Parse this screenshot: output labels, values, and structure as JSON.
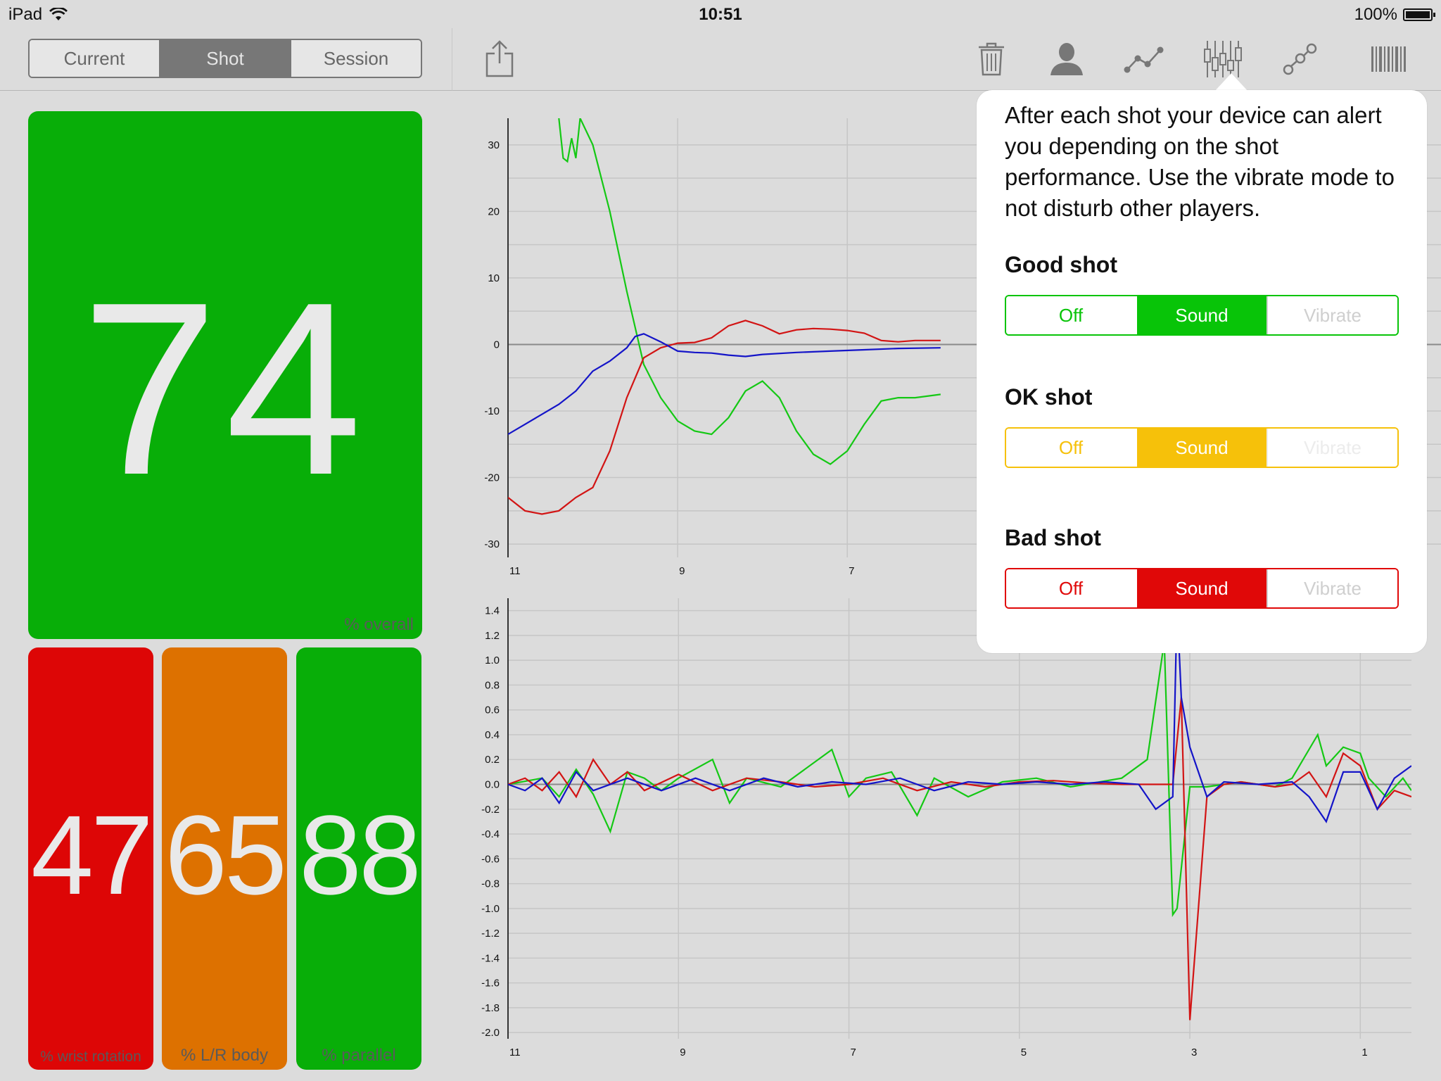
{
  "status_bar": {
    "device": "iPad",
    "time": "10:51",
    "battery": "100%"
  },
  "segmented": {
    "items": [
      "Current",
      "Shot",
      "Session"
    ],
    "selected": 1
  },
  "toolbar": {
    "icons": [
      "share-icon",
      "trash-icon",
      "person-icon",
      "line-graph-icon",
      "candlestick-icon",
      "scatter-icon",
      "barcode-icon"
    ]
  },
  "scores": {
    "overall": {
      "value": "74",
      "label": "% overall",
      "color": "#08ae08"
    },
    "wrist": {
      "value": "47",
      "label": "% wrist rotation",
      "color": "#dd0606"
    },
    "body": {
      "value": "65",
      "label": "% L/R body",
      "color": "#dd7100"
    },
    "parallel": {
      "value": "88",
      "label": "% parallel",
      "color": "#08ae08"
    }
  },
  "popover": {
    "text": "After each shot your device can alert you depending on the shot performance. Use the vibrate mode to not disturb other players.",
    "good": {
      "title": "Good shot",
      "options": [
        "Off",
        "Sound",
        "Vibrate"
      ],
      "selected": "Sound",
      "color": "#08c408"
    },
    "ok": {
      "title": "OK shot",
      "options": [
        "Off",
        "Sound",
        "Vibrate"
      ],
      "selected": "Sound",
      "color": "#f6c10a"
    },
    "bad": {
      "title": "Bad shot",
      "options": [
        "Off",
        "Sound",
        "Vibrate"
      ],
      "selected": "Sound",
      "color": "#e00808"
    }
  },
  "chart_data": [
    {
      "type": "line",
      "title": "",
      "xlabel": "",
      "ylabel": "",
      "xlim": [
        11,
        0
      ],
      "ylim": [
        -32,
        34
      ],
      "x_ticks": [
        11,
        9,
        7
      ],
      "y_ticks": [
        30,
        20,
        10,
        0,
        -10,
        -20,
        -30
      ],
      "grid": true,
      "series": [
        {
          "color": "#14c814",
          "points": [
            [
              10.4,
              34
            ],
            [
              10.35,
              28
            ],
            [
              10.3,
              27.5
            ],
            [
              10.25,
              31
            ],
            [
              10.2,
              28
            ],
            [
              10.15,
              34
            ],
            [
              10.0,
              30
            ],
            [
              9.8,
              20
            ],
            [
              9.6,
              8
            ],
            [
              9.4,
              -3
            ],
            [
              9.2,
              -8
            ],
            [
              9.0,
              -11.5
            ],
            [
              8.8,
              -13
            ],
            [
              8.6,
              -13.5
            ],
            [
              8.4,
              -11
            ],
            [
              8.2,
              -7
            ],
            [
              8.0,
              -5.5
            ],
            [
              7.8,
              -8
            ],
            [
              7.6,
              -13
            ],
            [
              7.4,
              -16.5
            ],
            [
              7.2,
              -18
            ],
            [
              7.0,
              -16
            ],
            [
              6.8,
              -12
            ],
            [
              6.6,
              -8.5
            ],
            [
              6.4,
              -8
            ],
            [
              6.2,
              -8
            ],
            [
              5.9,
              -7.5
            ]
          ]
        },
        {
          "color": "#d21414",
          "points": [
            [
              11.0,
              -23
            ],
            [
              10.8,
              -25
            ],
            [
              10.6,
              -25.5
            ],
            [
              10.4,
              -25
            ],
            [
              10.2,
              -23
            ],
            [
              10.0,
              -21.5
            ],
            [
              9.8,
              -16
            ],
            [
              9.6,
              -8
            ],
            [
              9.4,
              -2
            ],
            [
              9.2,
              -0.5
            ],
            [
              9.0,
              0.2
            ],
            [
              8.8,
              0.3
            ],
            [
              8.6,
              1
            ],
            [
              8.4,
              2.8
            ],
            [
              8.2,
              3.6
            ],
            [
              8.0,
              2.8
            ],
            [
              7.8,
              1.6
            ],
            [
              7.6,
              2.2
            ],
            [
              7.4,
              2.4
            ],
            [
              7.2,
              2.3
            ],
            [
              7.0,
              2.1
            ],
            [
              6.8,
              1.7
            ],
            [
              6.6,
              0.6
            ],
            [
              6.4,
              0.4
            ],
            [
              6.2,
              0.6
            ],
            [
              5.9,
              0.6
            ]
          ]
        },
        {
          "color": "#1414c8",
          "points": [
            [
              11.0,
              -13.5
            ],
            [
              10.8,
              -12
            ],
            [
              10.6,
              -10.5
            ],
            [
              10.4,
              -9
            ],
            [
              10.2,
              -7
            ],
            [
              10.0,
              -4
            ],
            [
              9.8,
              -2.5
            ],
            [
              9.6,
              -0.5
            ],
            [
              9.5,
              1.2
            ],
            [
              9.4,
              1.6
            ],
            [
              9.2,
              0.4
            ],
            [
              9.0,
              -1.0
            ],
            [
              8.8,
              -1.2
            ],
            [
              8.6,
              -1.3
            ],
            [
              8.4,
              -1.6
            ],
            [
              8.2,
              -1.8
            ],
            [
              8.0,
              -1.5
            ],
            [
              7.6,
              -1.2
            ],
            [
              7.2,
              -1.0
            ],
            [
              6.8,
              -0.8
            ],
            [
              6.4,
              -0.6
            ],
            [
              5.9,
              -0.5
            ]
          ]
        }
      ]
    },
    {
      "type": "line",
      "title": "",
      "xlabel": "",
      "ylabel": "",
      "xlim": [
        11,
        0.4
      ],
      "ylim": [
        -2.05,
        1.5
      ],
      "x_ticks": [
        11,
        9,
        7,
        5,
        3,
        1
      ],
      "y_ticks": [
        1.4,
        1.2,
        1.0,
        0.8,
        0.6,
        0.4,
        0.2,
        0.0,
        -0.2,
        -0.4,
        -0.6,
        -0.8,
        -1.0,
        -1.2,
        -1.4,
        -1.6,
        -1.8,
        -2.0
      ],
      "grid": true,
      "series": [
        {
          "color": "#14c814",
          "points": [
            [
              11,
              0
            ],
            [
              10.6,
              0.05
            ],
            [
              10.4,
              -0.1
            ],
            [
              10.2,
              0.12
            ],
            [
              10.0,
              -0.08
            ],
            [
              9.8,
              -0.38
            ],
            [
              9.6,
              0.1
            ],
            [
              9.4,
              0.05
            ],
            [
              9.2,
              -0.05
            ],
            [
              9.0,
              0.05
            ],
            [
              8.6,
              0.2
            ],
            [
              8.4,
              -0.15
            ],
            [
              8.2,
              0.05
            ],
            [
              7.8,
              -0.02
            ],
            [
              7.2,
              0.28
            ],
            [
              7.0,
              -0.1
            ],
            [
              6.8,
              0.05
            ],
            [
              6.5,
              0.1
            ],
            [
              6.2,
              -0.25
            ],
            [
              6.0,
              0.05
            ],
            [
              5.6,
              -0.1
            ],
            [
              5.2,
              0.02
            ],
            [
              4.8,
              0.05
            ],
            [
              4.4,
              -0.02
            ],
            [
              3.8,
              0.05
            ],
            [
              3.5,
              0.2
            ],
            [
              3.3,
              1.15
            ],
            [
              3.2,
              -1.05
            ],
            [
              3.15,
              -1.0
            ],
            [
              3.0,
              -0.02
            ],
            [
              2.8,
              -0.02
            ],
            [
              2.4,
              0.02
            ],
            [
              2.0,
              -0.02
            ],
            [
              1.8,
              0.05
            ],
            [
              1.5,
              0.4
            ],
            [
              1.4,
              0.15
            ],
            [
              1.2,
              0.3
            ],
            [
              1.0,
              0.25
            ],
            [
              0.9,
              0.05
            ],
            [
              0.7,
              -0.1
            ],
            [
              0.5,
              0.05
            ],
            [
              0.4,
              -0.05
            ]
          ]
        },
        {
          "color": "#d21414",
          "points": [
            [
              11,
              0.0
            ],
            [
              10.8,
              0.05
            ],
            [
              10.6,
              -0.05
            ],
            [
              10.4,
              0.1
            ],
            [
              10.2,
              -0.1
            ],
            [
              10.0,
              0.2
            ],
            [
              9.8,
              0.0
            ],
            [
              9.6,
              0.1
            ],
            [
              9.4,
              -0.05
            ],
            [
              9.0,
              0.08
            ],
            [
              8.6,
              -0.05
            ],
            [
              8.2,
              0.05
            ],
            [
              7.8,
              0.02
            ],
            [
              7.4,
              -0.02
            ],
            [
              7.0,
              0.0
            ],
            [
              6.6,
              0.05
            ],
            [
              6.2,
              -0.05
            ],
            [
              5.8,
              0.02
            ],
            [
              5.4,
              -0.02
            ],
            [
              5.0,
              0.02
            ],
            [
              4.6,
              0.03
            ],
            [
              4.2,
              0.01
            ],
            [
              3.8,
              0.0
            ],
            [
              3.4,
              0.0
            ],
            [
              3.2,
              0.0
            ],
            [
              3.1,
              0.7
            ],
            [
              3.0,
              -1.9
            ],
            [
              2.8,
              -0.1
            ],
            [
              2.6,
              0.0
            ],
            [
              2.4,
              0.02
            ],
            [
              2.2,
              0.0
            ],
            [
              2.0,
              -0.02
            ],
            [
              1.8,
              0.0
            ],
            [
              1.6,
              0.1
            ],
            [
              1.4,
              -0.1
            ],
            [
              1.2,
              0.25
            ],
            [
              1.0,
              0.15
            ],
            [
              0.8,
              -0.2
            ],
            [
              0.6,
              -0.05
            ],
            [
              0.4,
              -0.1
            ]
          ]
        },
        {
          "color": "#1414c8",
          "points": [
            [
              11,
              0.0
            ],
            [
              10.8,
              -0.05
            ],
            [
              10.6,
              0.05
            ],
            [
              10.4,
              -0.15
            ],
            [
              10.2,
              0.1
            ],
            [
              10.0,
              -0.05
            ],
            [
              9.6,
              0.05
            ],
            [
              9.2,
              -0.05
            ],
            [
              8.8,
              0.05
            ],
            [
              8.4,
              -0.05
            ],
            [
              8.0,
              0.05
            ],
            [
              7.6,
              -0.02
            ],
            [
              7.2,
              0.02
            ],
            [
              6.8,
              0.0
            ],
            [
              6.4,
              0.05
            ],
            [
              6.0,
              -0.05
            ],
            [
              5.6,
              0.02
            ],
            [
              5.2,
              0.0
            ],
            [
              4.8,
              0.02
            ],
            [
              4.4,
              0.0
            ],
            [
              4.0,
              0.02
            ],
            [
              3.6,
              0.0
            ],
            [
              3.4,
              -0.2
            ],
            [
              3.2,
              -0.1
            ],
            [
              3.15,
              1.45
            ],
            [
              3.1,
              0.7
            ],
            [
              3.0,
              0.3
            ],
            [
              2.8,
              -0.1
            ],
            [
              2.6,
              0.02
            ],
            [
              2.2,
              0.0
            ],
            [
              1.8,
              0.02
            ],
            [
              1.6,
              -0.1
            ],
            [
              1.5,
              -0.2
            ],
            [
              1.4,
              -0.3
            ],
            [
              1.2,
              0.1
            ],
            [
              1.0,
              0.1
            ],
            [
              0.8,
              -0.2
            ],
            [
              0.6,
              0.05
            ],
            [
              0.4,
              0.15
            ]
          ]
        }
      ]
    }
  ]
}
